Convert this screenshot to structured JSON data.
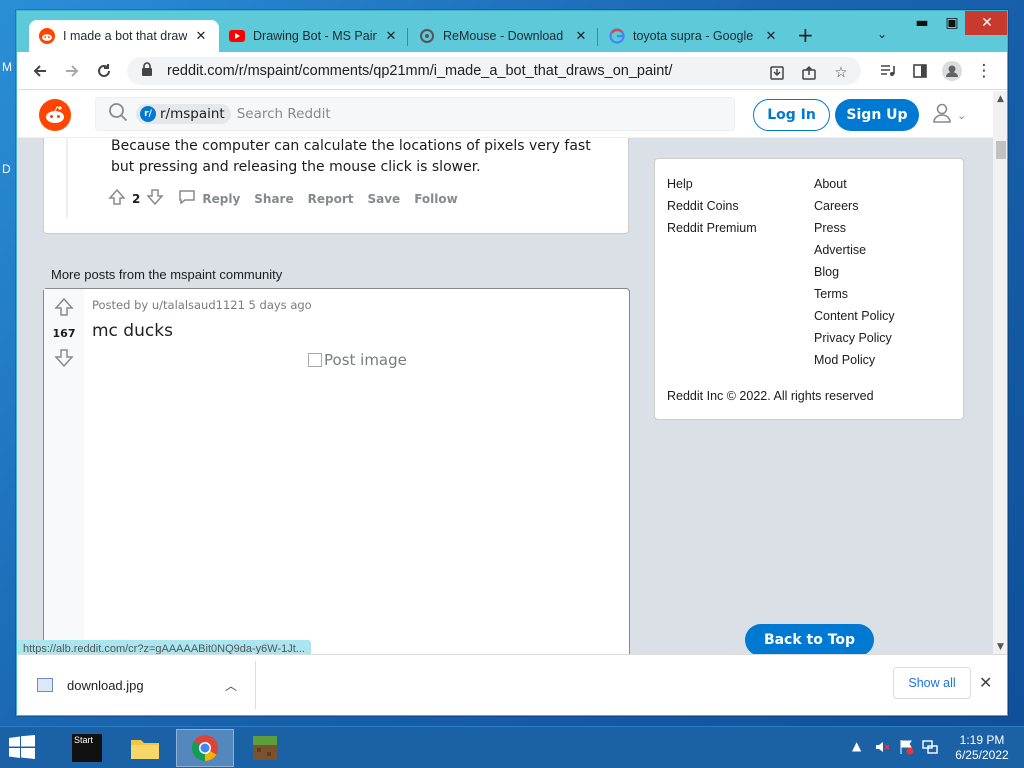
{
  "desktop": {
    "frag1": "M",
    "frag2": "D"
  },
  "browser": {
    "tabs": [
      {
        "title": "I made a bot that draws on paint",
        "icon": "reddit-icon",
        "active": true
      },
      {
        "title": "Drawing Bot - MS Paint",
        "icon": "youtube-icon",
        "active": false
      },
      {
        "title": "ReMouse - Download",
        "icon": "remouse-icon",
        "active": false
      },
      {
        "title": "toyota supra - Google Search",
        "icon": "google-icon",
        "active": false
      }
    ],
    "new_tab": "+",
    "url": "reddit.com/r/mspaint/comments/qp21mm/i_made_a_bot_that_draws_on_paint/"
  },
  "reddit": {
    "search": {
      "community": "r/mspaint",
      "placeholder": "Search Reddit"
    },
    "login_label": "Log In",
    "signup_label": "Sign Up",
    "comment": {
      "text": "Because the computer can calculate the locations of pixels very fast but pressing and releasing the mouse click is slower.",
      "votes": "2",
      "actions": [
        "Reply",
        "Share",
        "Report",
        "Save",
        "Follow"
      ]
    },
    "more_posts_title": "More posts from the mspaint community",
    "post": {
      "score": "167",
      "meta": "Posted by u/talalsaud1121 5 days ago",
      "title": "mc ducks",
      "image_alt": "Post image"
    },
    "sidebar": {
      "col1": [
        "Help",
        "Reddit Coins",
        "Reddit Premium"
      ],
      "col2": [
        "About",
        "Careers",
        "Press",
        "Advertise",
        "Blog",
        "Terms",
        "Content Policy",
        "Privacy Policy",
        "Mod Policy"
      ],
      "copyright": "Reddit Inc © 2022. All rights reserved"
    },
    "back_to_top": "Back to Top",
    "status_url": "https://alb.reddit.com/cr?z=gAAAAABit0NQ9da-y6W-1Jt..."
  },
  "downloads": {
    "file": "download.jpg",
    "show_all": "Show all"
  },
  "taskbar": {
    "start_label": "Start",
    "time": "1:19 PM",
    "date": "6/25/2022"
  },
  "colors": {
    "reddit_blue": "#0079d3",
    "reddit_orange": "#ff4500",
    "chrome_tabstrip": "#5ec9d9"
  }
}
